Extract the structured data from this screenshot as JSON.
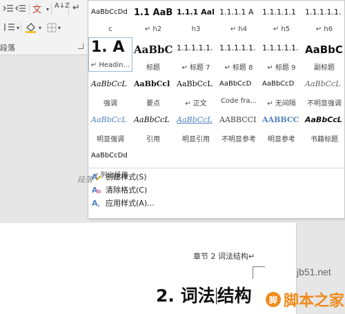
{
  "ribbon": {
    "group_label": "段落",
    "sort_label": "A↓Z",
    "pilcrow": "↵"
  },
  "styles": [
    {
      "sample": "AaBbCcDd",
      "caption": "c",
      "sample_size": "10px",
      "sample_weight": "normal"
    },
    {
      "sample": "1.1 AaB",
      "caption": "↵ h2",
      "sample_size": "13px",
      "sample_weight": "bold"
    },
    {
      "sample": "1.1.1 Aal",
      "caption": "h3",
      "sample_size": "11px",
      "sample_weight": "bold"
    },
    {
      "sample": "1.1.1.1 A",
      "caption": "↵ h4",
      "sample_size": "11px",
      "sample_weight": "normal"
    },
    {
      "sample": "1.1.1.1.1",
      "caption": "↵ h5",
      "sample_size": "11px",
      "sample_weight": "normal"
    },
    {
      "sample": "1.1.1.1.1.",
      "caption": "↵ h6",
      "sample_size": "11px",
      "sample_weight": "normal"
    },
    {
      "sample": "1.  A",
      "caption": "↵ Headin...",
      "sample_size": "22px",
      "sample_weight": "bold",
      "selected": true
    },
    {
      "sample": "AaBbC",
      "caption": "标题",
      "sample_size": "15px",
      "sample_weight": "bold",
      "serif": true
    },
    {
      "sample": "1.1.1.1.1.",
      "caption": "↵ 标题 7",
      "sample_size": "11px",
      "sample_weight": "normal"
    },
    {
      "sample": "1.1.1.1.1.",
      "caption": "↵ 标题 8",
      "sample_size": "11px",
      "sample_weight": "normal"
    },
    {
      "sample": "1.1.1.1.1.",
      "caption": "↵ 标题 9",
      "sample_size": "11px",
      "sample_weight": "normal"
    },
    {
      "sample": "AaBbC",
      "caption": "副标题",
      "sample_size": "15px",
      "sample_weight": "bold"
    },
    {
      "sample": "AaBbCcL",
      "caption": "强调",
      "sample_size": "11px",
      "sample_weight": "normal",
      "italic": true,
      "serif": true
    },
    {
      "sample": "AaBbCcl",
      "caption": "要点",
      "sample_size": "11px",
      "sample_weight": "bold",
      "serif": true
    },
    {
      "sample": "AaBbCcL",
      "caption": "↵ 正文",
      "sample_size": "11px",
      "sample_weight": "normal",
      "serif": true
    },
    {
      "sample": "AaBbCcD",
      "caption": "Code fra...",
      "sample_size": "10px",
      "sample_weight": "normal"
    },
    {
      "sample": "AaBbCcD",
      "caption": "↵ 无间隔",
      "sample_size": "10px",
      "sample_weight": "normal"
    },
    {
      "sample": "AaBbCcL",
      "caption": "不明显强调",
      "sample_size": "11px",
      "sample_weight": "normal",
      "italic": true,
      "serif": true,
      "color": "#666666"
    },
    {
      "sample": "AaBbCcL",
      "caption": "明显强调",
      "sample_size": "11px",
      "sample_weight": "normal",
      "italic": true,
      "serif": true,
      "color": "#4f81bd"
    },
    {
      "sample": "AaBbCcL",
      "caption": "引用",
      "sample_size": "11px",
      "sample_weight": "normal",
      "italic": true,
      "serif": true
    },
    {
      "sample": "AaBbCcL",
      "caption": "明显引用",
      "sample_size": "11px",
      "sample_weight": "normal",
      "italic": true,
      "serif": true,
      "color": "#4f81bd",
      "underline": true
    },
    {
      "sample": "AABBCCI",
      "caption": "不明显参考",
      "sample_size": "11px",
      "sample_weight": "normal",
      "serif": true,
      "color": "#444444"
    },
    {
      "sample": "AABBCC",
      "caption": "明显参考",
      "sample_size": "11px",
      "sample_weight": "bold",
      "serif": true,
      "color": "#4f81bd"
    },
    {
      "sample": "AaBbCcL",
      "caption": "书籍标题",
      "sample_size": "11px",
      "sample_weight": "bold",
      "italic": true
    },
    {
      "sample": "AaBbCcDd",
      "caption": "↵ 列出段落",
      "sample_size": "10px",
      "sample_weight": "normal"
    }
  ],
  "menu": [
    {
      "label": "创建样式(S)",
      "icon": "create-style-icon"
    },
    {
      "label": "清除格式(C)",
      "icon": "clear-format-icon"
    },
    {
      "label": "应用样式(A)...",
      "icon": "apply-style-icon"
    }
  ],
  "side_label": "段落",
  "document": {
    "header": "章节 2   词法结构↵",
    "heading_num": "2.",
    "heading_part1": "词法",
    "heading_part2": "结构"
  },
  "watermark": {
    "site": "jb51.net",
    "brand": "脚本之家",
    "logo": "脚"
  },
  "colors": {
    "accent_blue": "#4f81bd",
    "watermark_orange": "#f08a1c"
  }
}
